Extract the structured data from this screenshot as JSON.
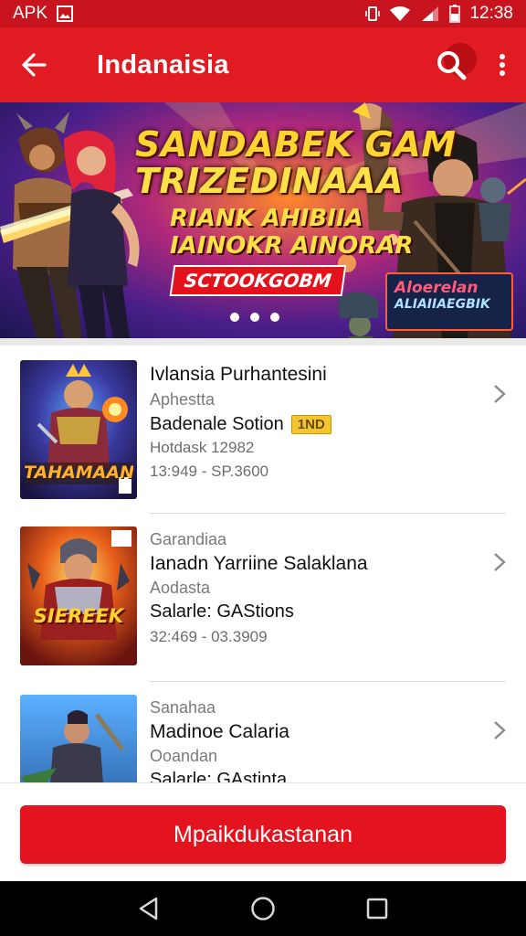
{
  "status_bar": {
    "carrier_label": "APK",
    "time": "12:38",
    "icons": [
      "image-icon",
      "vibrate-icon",
      "wifi-icon",
      "signal-icon",
      "battery-icon"
    ]
  },
  "app_bar": {
    "title": "Indanaisia",
    "icons": [
      "back-arrow-icon",
      "search-icon",
      "more-vert-icon"
    ]
  },
  "banner": {
    "headline_1": "SANDABEK GAM",
    "headline_2": "TRIZEDINAAA",
    "subline_1": "RIANK AHIBIIA",
    "subline_2": "IAINOKR AINORAR",
    "cta_label": "SCTOOKGOBM",
    "badge_line_1": "Aloerelan",
    "badge_line_2": "ALIAIIAEGBIK",
    "page_count": 3
  },
  "list": {
    "items": [
      {
        "title": "Ivlansia Purhantesini",
        "subtitle": "Aphestta",
        "highlight": "Badenale Sotion",
        "tag": "1ND",
        "detail": "Hotdask 12982",
        "meta": "13:949 - SP.3600",
        "thumb_caption": "TAHAMAAN"
      },
      {
        "category": "Garandiaa",
        "title": "Ianadn Yarriine Salaklana",
        "subtitle": "Aodasta",
        "highlight": "Salarle: GAStions",
        "meta": "32:469 - 03.3909",
        "thumb_caption": "SIEREEK"
      },
      {
        "category": "Sanahaa",
        "title": "Madinoe Calaria",
        "subtitle": "Ooandan",
        "highlight": "Salarle: GAstinta"
      }
    ]
  },
  "primary_action": {
    "label": "Mpaikdukastanan"
  },
  "nav_bar": {
    "icons": [
      "back-triangle-icon",
      "home-circle-icon",
      "recents-square-icon"
    ]
  },
  "colors": {
    "brand_red": "#e11b22",
    "status_bar_red": "#c8141f",
    "button_red": "#e3141f",
    "tag_yellow": "#f3c531"
  }
}
